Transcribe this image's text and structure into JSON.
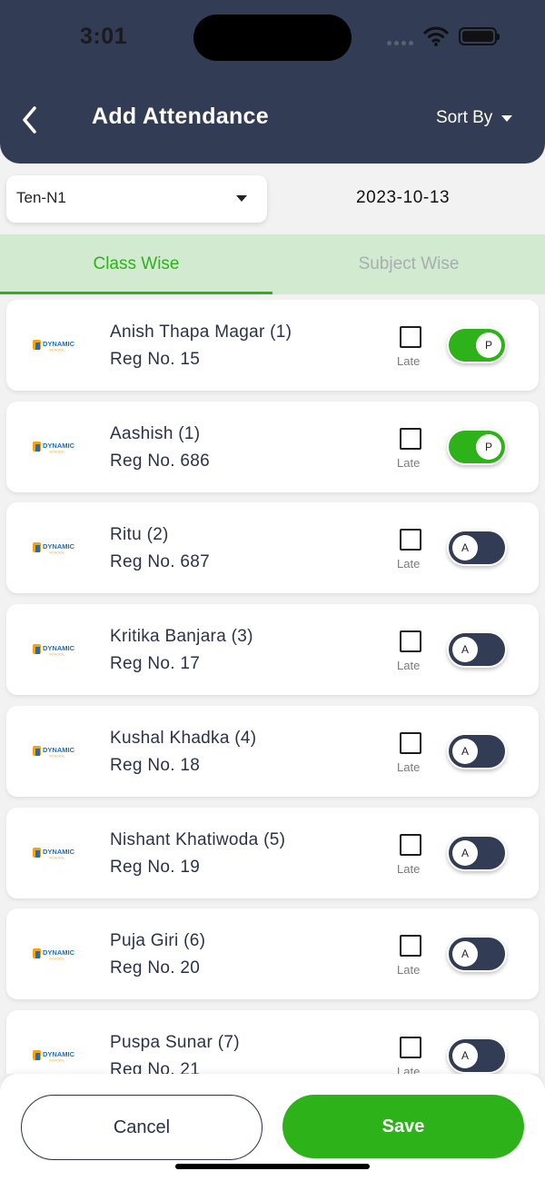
{
  "status_bar": {
    "time": "3:01"
  },
  "header": {
    "title": "Add Attendance",
    "sort_label": "Sort By",
    "back_icon": "chevron-left-icon",
    "sort_icon": "caret-down-icon"
  },
  "filters": {
    "class_value": "Ten-N1",
    "date": "2023-10-13"
  },
  "tabs": [
    {
      "label": "Class Wise",
      "active": true
    },
    {
      "label": "Subject Wise",
      "active": false
    }
  ],
  "students": [
    {
      "name": "Anish Thapa Magar (1)",
      "reg": "Reg No. 15",
      "late_label": "Late",
      "late": false,
      "status": "P"
    },
    {
      "name": "Aashish (1)",
      "reg": "Reg No. 686",
      "late_label": "Late",
      "late": false,
      "status": "P"
    },
    {
      "name": "Ritu (2)",
      "reg": "Reg No. 687",
      "late_label": "Late",
      "late": false,
      "status": "A"
    },
    {
      "name": "Kritika Banjara (3)",
      "reg": "Reg No. 17",
      "late_label": "Late",
      "late": false,
      "status": "A"
    },
    {
      "name": "Kushal Khadka (4)",
      "reg": "Reg No. 18",
      "late_label": "Late",
      "late": false,
      "status": "A"
    },
    {
      "name": "Nishant Khatiwoda (5)",
      "reg": "Reg No. 19",
      "late_label": "Late",
      "late": false,
      "status": "A"
    },
    {
      "name": "Puja Giri (6)",
      "reg": "Reg No. 20",
      "late_label": "Late",
      "late": false,
      "status": "A"
    },
    {
      "name": "Puspa Sunar (7)",
      "reg": "Reg No. 21",
      "late_label": "Late",
      "late": false,
      "status": "A"
    }
  ],
  "actions": {
    "cancel_label": "Cancel",
    "save_label": "Save"
  },
  "colors": {
    "header": "#323c55",
    "accent_green": "#2db21a",
    "tab_bg": "#d2ead0",
    "toggle_absent": "#323c55"
  }
}
